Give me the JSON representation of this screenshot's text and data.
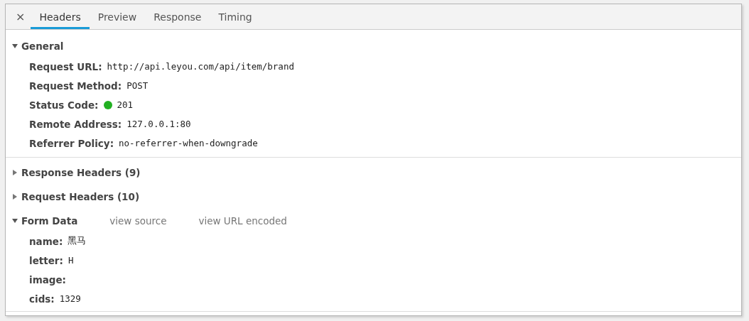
{
  "close_label": "×",
  "tabs": [
    {
      "label": "Headers",
      "selected": true
    },
    {
      "label": "Preview",
      "selected": false
    },
    {
      "label": "Response",
      "selected": false
    },
    {
      "label": "Timing",
      "selected": false
    }
  ],
  "sections": [
    {
      "title": "General",
      "expanded": true,
      "rows": [
        {
          "key": "Request URL:",
          "value": "http://api.leyou.com/api/item/brand"
        },
        {
          "key": "Request Method:",
          "value": "POST"
        },
        {
          "key": "Status Code:",
          "value": "201",
          "color": "#22b022"
        },
        {
          "key": "Remote Address:",
          "value": "127.0.0.1:80"
        },
        {
          "key": "Referrer Policy:",
          "value": "no-referrer-when-downgrade"
        }
      ]
    },
    {
      "title": "Response Headers (9)",
      "expanded": false
    },
    {
      "title": "Request Headers (10)",
      "expanded": false
    },
    {
      "title": "Form Data",
      "expanded": true,
      "links": [
        "view source",
        "view URL encoded"
      ],
      "rows": [
        {
          "key": "name:",
          "value": "黑马"
        },
        {
          "key": "letter:",
          "value": "H"
        },
        {
          "key": "image:"
        },
        {
          "key": "cids:",
          "value": "1329"
        }
      ]
    }
  ]
}
